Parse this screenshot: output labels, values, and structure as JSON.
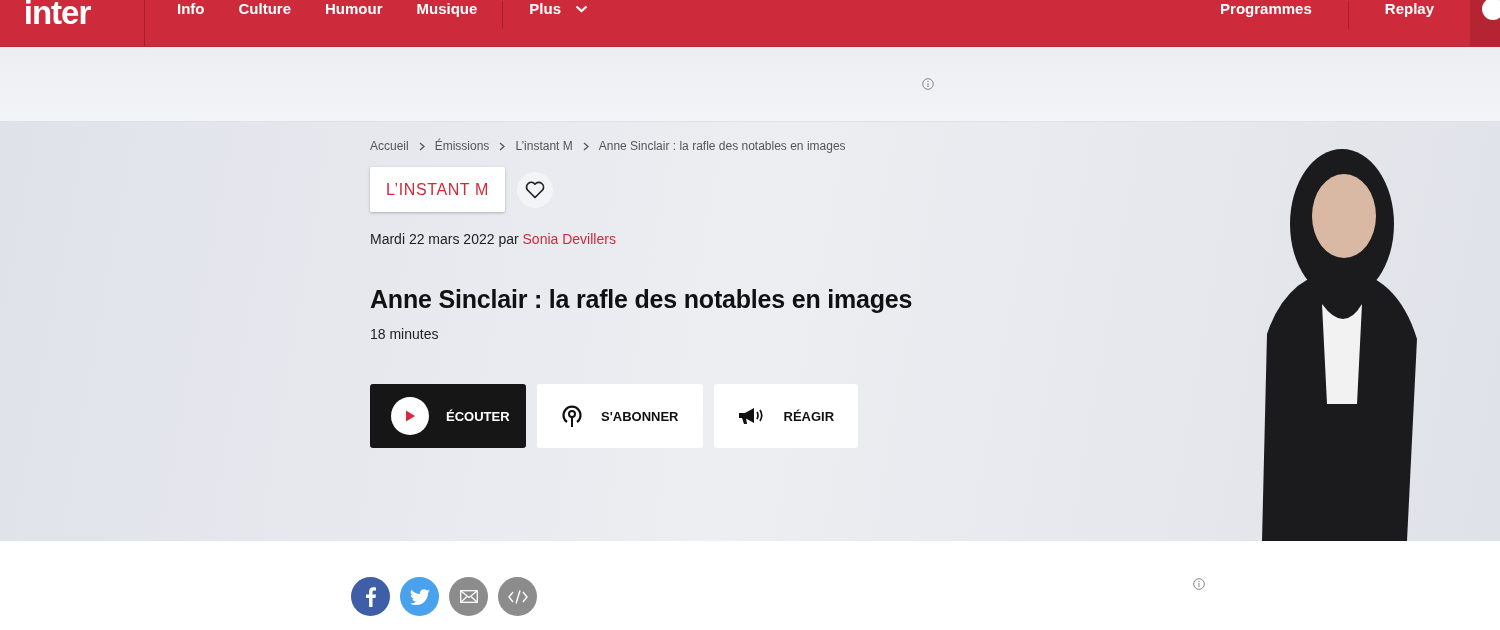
{
  "header": {
    "logo": "inter",
    "nav": [
      {
        "label": "Info",
        "kind": "link"
      },
      {
        "label": "Culture",
        "kind": "link"
      },
      {
        "label": "Humour",
        "kind": "link"
      },
      {
        "label": "Musique",
        "kind": "link"
      },
      {
        "label": "Plus",
        "kind": "dropdown"
      }
    ],
    "right_nav": [
      "Programmes",
      "Replay"
    ]
  },
  "breadcrumb": [
    "Accueil",
    "Émissions",
    "L’instant M",
    "Anne Sinclair : la rafle des notables en images"
  ],
  "show_tag": "L’INSTANT M",
  "byline": {
    "date": "Mardi 22 mars 2022",
    "by": "par",
    "author": "Sonia Devillers"
  },
  "title": "Anne Sinclair : la rafle des notables en images",
  "duration": "18 minutes",
  "actions": [
    {
      "label": "ÉCOUTER",
      "kind": "play"
    },
    {
      "label": "S'ABONNER",
      "kind": "podcast"
    },
    {
      "label": "RÉAGIR",
      "kind": "megaphone"
    }
  ],
  "share": [
    {
      "kind": "facebook"
    },
    {
      "kind": "twitter"
    },
    {
      "kind": "email"
    },
    {
      "kind": "embed"
    }
  ]
}
